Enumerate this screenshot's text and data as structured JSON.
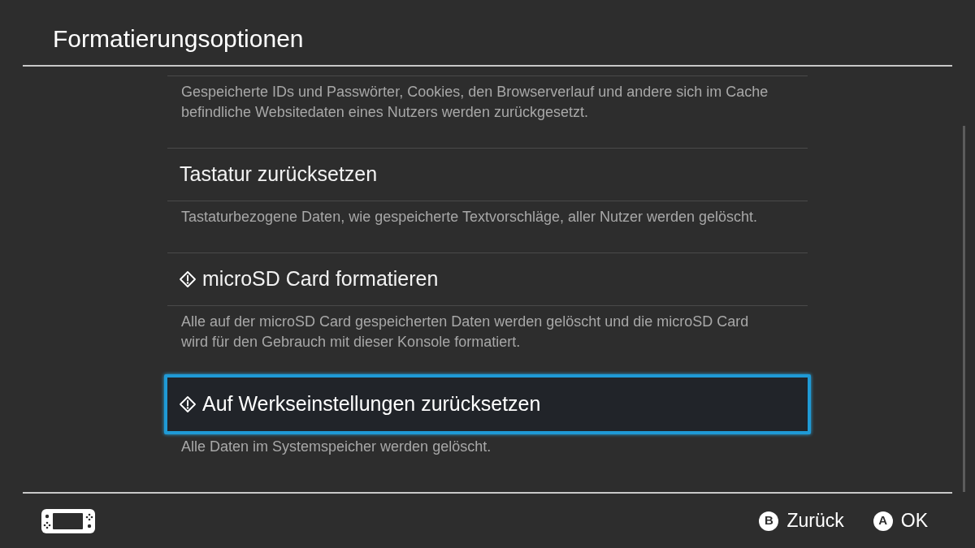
{
  "window": {
    "title": "Formatierungsoptionen"
  },
  "options": [
    {
      "description": "Gespeicherte IDs und Passwörter, Cookies, den Browserverlauf und andere sich im Cache befindliche Websitedaten eines Nutzers werden zurückgesetzt.",
      "selected": false
    },
    {
      "label": "Tastatur zurücksetzen",
      "warning": false,
      "selected": false,
      "description": "Tastaturbezogene Daten, wie gespeicherte Textvorschläge, aller Nutzer werden gelöscht."
    },
    {
      "label": "microSD Card formatieren",
      "warning": true,
      "selected": false,
      "description": "Alle auf der microSD Card gespeicherten Daten werden gelöscht und die microSD Card wird für den Gebrauch mit dieser Konsole formatiert."
    },
    {
      "label": "Auf Werkseinstellungen zurücksetzen",
      "warning": true,
      "selected": true,
      "description": "Alle Daten im Systemspeicher werden gelöscht."
    }
  ],
  "footer": {
    "buttons": [
      {
        "key": "B",
        "label": "Zurück"
      },
      {
        "key": "A",
        "label": "OK"
      }
    ]
  }
}
